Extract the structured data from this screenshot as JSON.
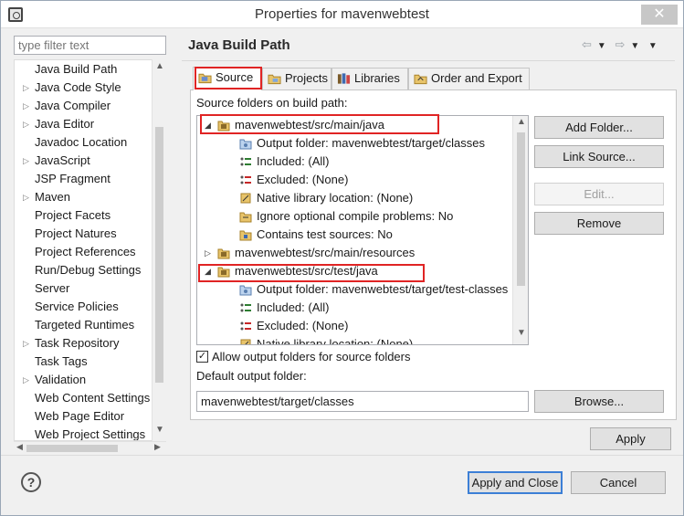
{
  "window": {
    "title": "Properties for mavenwebtest",
    "close_glyph": "✕"
  },
  "filter": {
    "placeholder": "type filter text"
  },
  "nav": {
    "items": [
      {
        "label": "Java Build Path",
        "expandable": false,
        "selected": true
      },
      {
        "label": "Java Code Style",
        "expandable": true
      },
      {
        "label": "Java Compiler",
        "expandable": true
      },
      {
        "label": "Java Editor",
        "expandable": true
      },
      {
        "label": "Javadoc Location",
        "expandable": false
      },
      {
        "label": "JavaScript",
        "expandable": true
      },
      {
        "label": "JSP Fragment",
        "expandable": false
      },
      {
        "label": "Maven",
        "expandable": true
      },
      {
        "label": "Project Facets",
        "expandable": false
      },
      {
        "label": "Project Natures",
        "expandable": false
      },
      {
        "label": "Project References",
        "expandable": false
      },
      {
        "label": "Run/Debug Settings",
        "expandable": false
      },
      {
        "label": "Server",
        "expandable": false
      },
      {
        "label": "Service Policies",
        "expandable": false
      },
      {
        "label": "Targeted Runtimes",
        "expandable": false
      },
      {
        "label": "Task Repository",
        "expandable": true
      },
      {
        "label": "Task Tags",
        "expandable": false
      },
      {
        "label": "Validation",
        "expandable": true
      },
      {
        "label": "Web Content Settings",
        "expandable": false
      },
      {
        "label": "Web Page Editor",
        "expandable": false
      },
      {
        "label": "Web Project Settings",
        "expandable": false
      }
    ]
  },
  "page": {
    "title": "Java Build Path"
  },
  "tabs": [
    {
      "label": "Source",
      "icon": "source-folder-icon",
      "active": true
    },
    {
      "label": "Projects",
      "icon": "projects-icon"
    },
    {
      "label": "Libraries",
      "icon": "libraries-icon"
    },
    {
      "label": "Order and Export",
      "icon": "order-export-icon"
    }
  ],
  "source": {
    "section_label": "Source folders on build path:",
    "tree": [
      {
        "label": "mavenwebtest/src/main/java",
        "level": 0,
        "twisty": "expanded",
        "icon": "package-folder-icon"
      },
      {
        "label": "Output folder: mavenwebtest/target/classes",
        "level": 1,
        "icon": "output-folder-icon"
      },
      {
        "label": "Included: (All)",
        "level": 1,
        "icon": "included-icon"
      },
      {
        "label": "Excluded: (None)",
        "level": 1,
        "icon": "excluded-icon"
      },
      {
        "label": "Native library location: (None)",
        "level": 1,
        "icon": "native-library-icon"
      },
      {
        "label": "Ignore optional compile problems: No",
        "level": 1,
        "icon": "ignore-problems-icon"
      },
      {
        "label": "Contains test sources: No",
        "level": 1,
        "icon": "test-sources-icon"
      },
      {
        "label": "mavenwebtest/src/main/resources",
        "level": 0,
        "twisty": "collapsed",
        "icon": "package-folder-icon"
      },
      {
        "label": "mavenwebtest/src/test/java",
        "level": 0,
        "twisty": "expanded",
        "icon": "package-folder-icon"
      },
      {
        "label": "Output folder: mavenwebtest/target/test-classes",
        "level": 1,
        "icon": "output-folder-icon"
      },
      {
        "label": "Included: (All)",
        "level": 1,
        "icon": "included-icon"
      },
      {
        "label": "Excluded: (None)",
        "level": 1,
        "icon": "excluded-icon"
      },
      {
        "label": "Native library location: (None)",
        "level": 1,
        "icon": "native-library-icon"
      }
    ],
    "buttons": {
      "add_folder": "Add Folder...",
      "link_source": "Link Source...",
      "edit": "Edit...",
      "remove": "Remove"
    },
    "allow_output_label": "Allow output folders for source folders",
    "allow_output_checked": true,
    "default_output_label": "Default output folder:",
    "default_output_value": "mavenwebtest/target/classes",
    "browse": "Browse..."
  },
  "footer": {
    "apply": "Apply",
    "apply_close": "Apply and Close",
    "cancel": "Cancel",
    "help_glyph": "?"
  }
}
